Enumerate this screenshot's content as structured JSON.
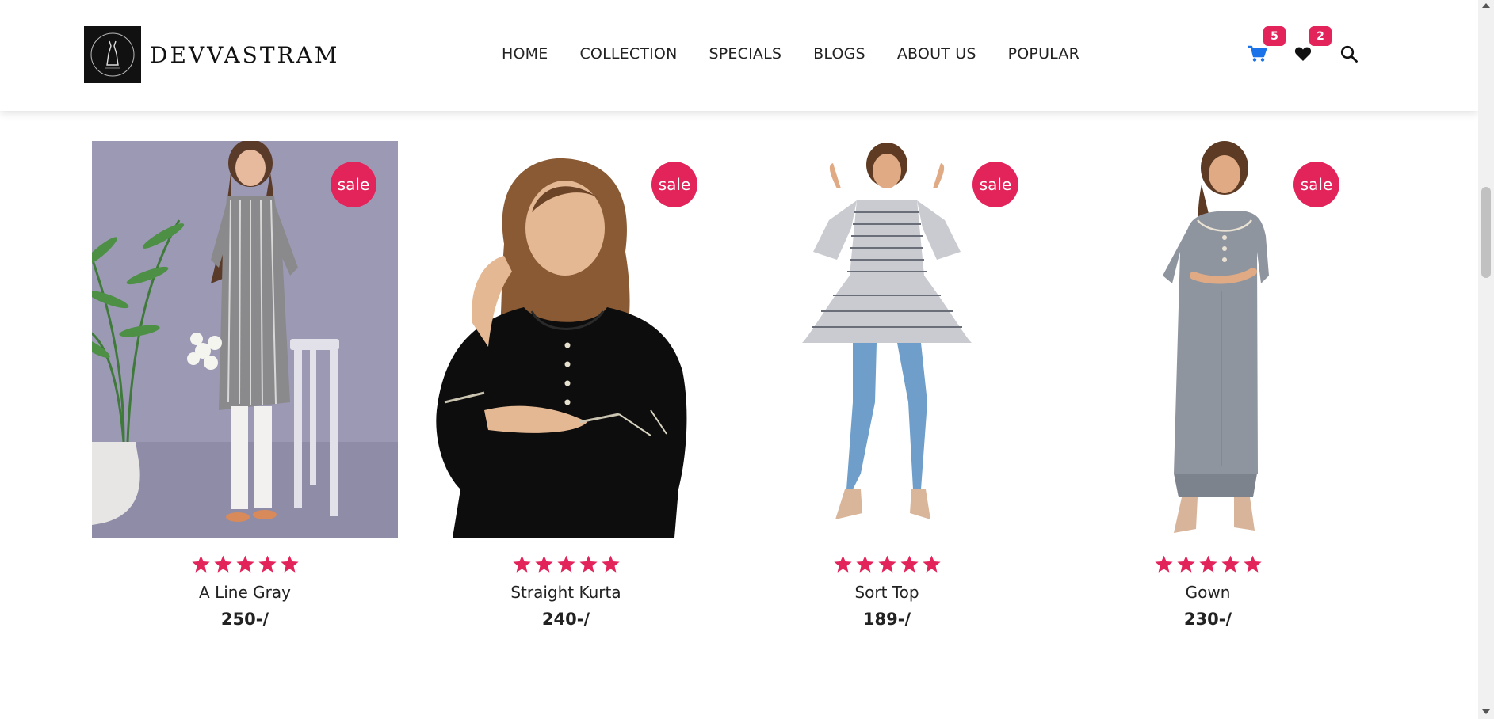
{
  "brand": {
    "name": "DEVVASTRAM",
    "logo_icon": "dress-logo-icon"
  },
  "nav": [
    "HOME",
    "COLLECTION",
    "SPECIALS",
    "BLOGS",
    "ABOUT US",
    "POPULAR"
  ],
  "header_icons": {
    "cart": {
      "icon": "cart-icon",
      "count": "5",
      "color": "#1a73e8"
    },
    "wishlist": {
      "icon": "heart-icon",
      "count": "2"
    },
    "search": {
      "icon": "search-icon"
    }
  },
  "colors": {
    "accent": "#e2245a",
    "cart": "#1a73e8"
  },
  "products": [
    {
      "name": "A Line Gray",
      "price": "250-/",
      "badge": "sale",
      "rating": 5
    },
    {
      "name": "Straight Kurta",
      "price": "240-/",
      "badge": "sale",
      "rating": 5
    },
    {
      "name": "Sort Top",
      "price": "189-/",
      "badge": "sale",
      "rating": 5
    },
    {
      "name": "Gown",
      "price": "230-/",
      "badge": "sale",
      "rating": 5
    }
  ]
}
